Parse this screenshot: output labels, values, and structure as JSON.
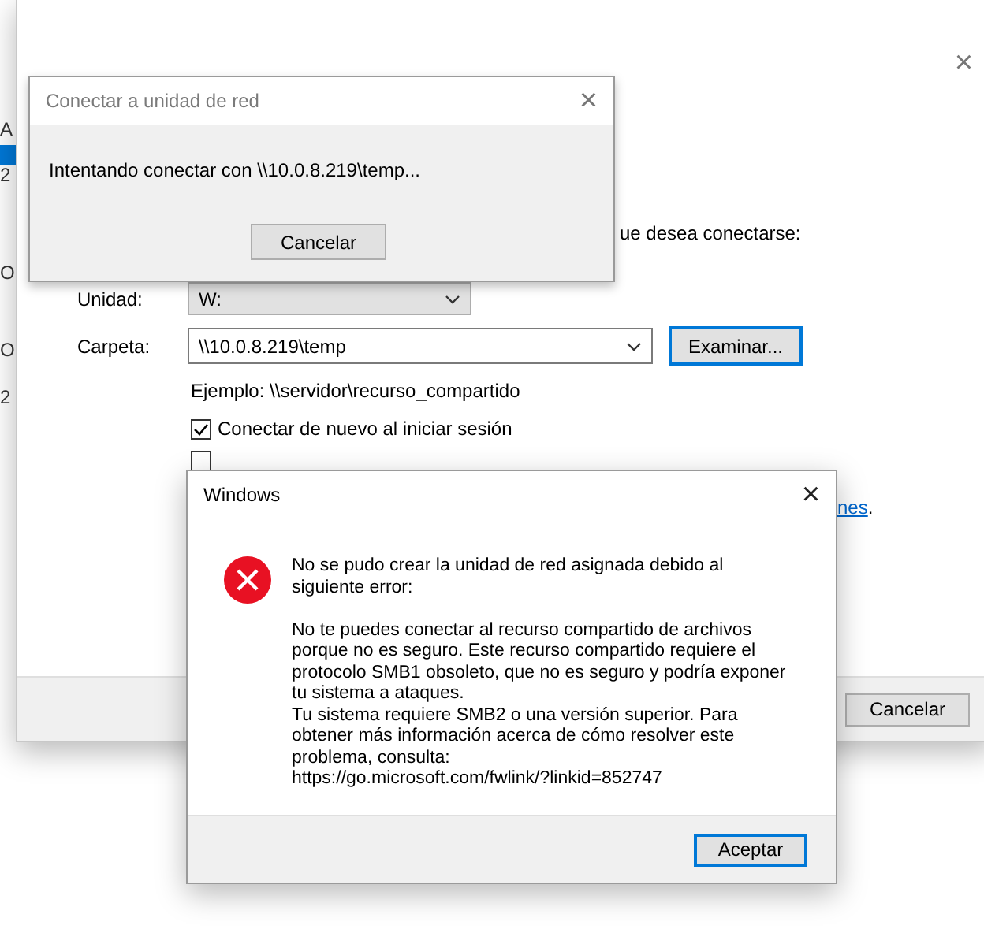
{
  "background_window": {
    "fragments": [
      {
        "kind": "text",
        "text": "A"
      },
      {
        "kind": "highlight"
      },
      {
        "kind": "text",
        "text": "2"
      },
      {
        "kind": "text",
        "text": "O"
      },
      {
        "kind": "text",
        "text": "O"
      },
      {
        "kind": "text",
        "text": "2"
      }
    ]
  },
  "map_drive_window": {
    "close": "×",
    "intro": "ue desea conectarse:",
    "fields": [
      {
        "kind": "select",
        "label": "Unidad:",
        "value": "W:"
      },
      {
        "kind": "combo",
        "label": "Carpeta:",
        "value": "\\\\10.0.8.219\\temp",
        "button": "Examinar..."
      }
    ],
    "example": "Ejemplo: \\\\servidor\\recurso_compartido",
    "checkboxes": [
      {
        "label": "Conectar de nuevo al iniciar sesión",
        "checked": true
      },
      {
        "checked": false
      }
    ],
    "link": "nes",
    "link_suffix": ".",
    "buttons": [
      "Cancelar"
    ]
  },
  "progress_dialog": {
    "title": "Conectar a unidad de red",
    "close": "×",
    "message": "Intentando conectar con \\\\10.0.8.219\\temp...",
    "button": "Cancelar"
  },
  "error_dialog": {
    "title": "Windows",
    "close": "×",
    "paragraphs": [
      "No se pudo crear la unidad de red asignada debido al siguiente error:",
      "No te puedes conectar al recurso compartido de archivos porque no es seguro. Este recurso compartido requiere el protocolo SMB1 obsoleto, que no es seguro y podría exponer tu sistema a ataques.",
      "Tu sistema requiere SMB2 o una versión superior. Para obtener más información acerca de cómo resolver este problema, consulta:",
      "https://go.microsoft.com/fwlink/?linkid=852747"
    ],
    "button": "Aceptar"
  }
}
